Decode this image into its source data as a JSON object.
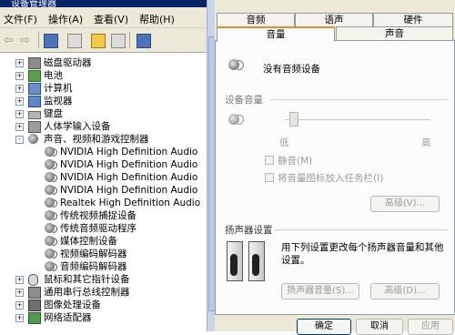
{
  "device_manager": {
    "title": "设备管理器",
    "menu": [
      {
        "label": "文件(F)"
      },
      {
        "label": "操作(A)"
      },
      {
        "label": "查看(V)"
      },
      {
        "label": "帮助(H)"
      }
    ],
    "toolbar": {
      "back_icon": "back-arrow-icon",
      "forward_icon": "forward-arrow-icon",
      "icons": [
        "properties-icon",
        "print-icon",
        "help-icon",
        "view-icon",
        "scan-icon"
      ]
    },
    "tree": [
      {
        "label": "磁盘驱动器",
        "expander": "+",
        "icon": "disk-drive-icon"
      },
      {
        "label": "电池",
        "expander": "+",
        "icon": "battery-icon"
      },
      {
        "label": "计算机",
        "expander": "+",
        "icon": "computer-icon"
      },
      {
        "label": "监视器",
        "expander": "+",
        "icon": "monitor-icon"
      },
      {
        "label": "键盘",
        "expander": "+",
        "icon": "keyboard-icon"
      },
      {
        "label": "人体学输入设备",
        "expander": "+",
        "icon": "hid-icon"
      },
      {
        "label": "声音、视频和游戏控制器",
        "expander": "-",
        "icon": "sound-controller-icon"
      },
      {
        "label": "NVIDIA High Definition Audio",
        "sub": true
      },
      {
        "label": "NVIDIA High Definition Audio",
        "sub": true
      },
      {
        "label": "NVIDIA High Definition Audio",
        "sub": true
      },
      {
        "label": "NVIDIA High Definition Audio",
        "sub": true
      },
      {
        "label": "Realtek High Definition Audio",
        "sub": true
      },
      {
        "label": "传统视频捕捉设备",
        "sub": true
      },
      {
        "label": "传统音频驱动程序",
        "sub": true
      },
      {
        "label": "媒体控制设备",
        "sub": true
      },
      {
        "label": "视频编码解码器",
        "sub": true
      },
      {
        "label": "音频编码解码器",
        "sub": true
      },
      {
        "label": "鼠标和其它指针设备",
        "expander": "+",
        "icon": "mouse-icon"
      },
      {
        "label": "通用串行总线控制器",
        "expander": "+",
        "icon": "usb-icon"
      },
      {
        "label": "图像处理设备",
        "expander": "+",
        "icon": "imaging-icon"
      },
      {
        "label": "网络适配器",
        "expander": "+",
        "icon": "network-adapter-icon"
      }
    ]
  },
  "dialog": {
    "tabs_back": [
      {
        "label": "音频"
      },
      {
        "label": "语声"
      },
      {
        "label": "硬件"
      }
    ],
    "tabs_front": [
      {
        "label": "音量"
      },
      {
        "label": "声音"
      }
    ],
    "active_tab": "音量",
    "device_label": "没有音频设备",
    "volume_group": {
      "title": "设备音量",
      "low": "低",
      "high": "高",
      "slider_level": 0.0,
      "mute_label": "静音(M)",
      "tray_label": "将音量图标放入任务栏(I)",
      "advanced_label": "高级(V)..."
    },
    "speaker_group": {
      "title": "扬声器设置",
      "description": "用下列设置更改每个扬声器音量和其他设置。",
      "speaker_volume_label": "扬声器音量(S)...",
      "advanced_label": "高级(D)..."
    },
    "buttons": {
      "ok": "确定",
      "cancel": "取消",
      "apply": "应用"
    },
    "colors": {
      "active_tab_accent": "#e68b2c",
      "disabled_text": "#9a9a9a",
      "group_title": "#7a7a7a"
    }
  }
}
